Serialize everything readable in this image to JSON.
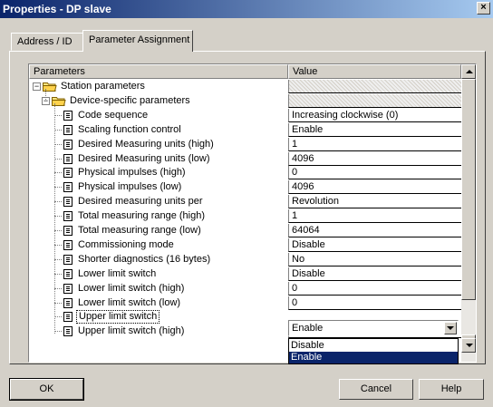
{
  "window": {
    "title": "Properties - DP slave",
    "close_glyph": "×"
  },
  "tabs": [
    {
      "label": "Address / ID",
      "active": false
    },
    {
      "label": "Parameter Assignment",
      "active": true
    }
  ],
  "grid": {
    "columns": {
      "parameters": "Parameters",
      "value": "Value"
    },
    "rows": [
      {
        "label": "Station parameters",
        "value": "",
        "type": "folder"
      },
      {
        "label": "Device-specific parameters",
        "value": "",
        "type": "folder"
      },
      {
        "label": "Code sequence",
        "value": "Increasing clockwise (0)",
        "type": "param"
      },
      {
        "label": "Scaling function control",
        "value": "Enable",
        "type": "param"
      },
      {
        "label": "Desired Measuring units (high)",
        "value": "1",
        "type": "param"
      },
      {
        "label": "Desired Measuring units (low)",
        "value": "4096",
        "type": "param"
      },
      {
        "label": "Physical impulses (high)",
        "value": "0",
        "type": "param"
      },
      {
        "label": "Physical impulses (low)",
        "value": "4096",
        "type": "param"
      },
      {
        "label": "Desired measuring units per",
        "value": "Revolution",
        "type": "param"
      },
      {
        "label": "Total measuring range (high)",
        "value": "1",
        "type": "param"
      },
      {
        "label": "Total measuring range (low)",
        "value": "64064",
        "type": "param"
      },
      {
        "label": "Commissioning mode",
        "value": "Disable",
        "type": "param"
      },
      {
        "label": "Shorter diagnostics (16 bytes)",
        "value": "No",
        "type": "param"
      },
      {
        "label": "Lower limit switch",
        "value": "Disable",
        "type": "param"
      },
      {
        "label": "Lower limit switch (high)",
        "value": "0",
        "type": "param"
      },
      {
        "label": "Lower limit switch (low)",
        "value": "0",
        "type": "param"
      },
      {
        "label": "Upper limit switch",
        "value": "Enable",
        "type": "param",
        "selected": true
      },
      {
        "label": "Upper limit switch (high)",
        "value": "",
        "type": "param"
      }
    ]
  },
  "dropdown": {
    "selected": "Enable",
    "options": [
      {
        "label": "Disable",
        "highlighted": false
      },
      {
        "label": "Enable",
        "highlighted": true
      }
    ]
  },
  "buttons": {
    "ok": "OK",
    "cancel": "Cancel",
    "help": "Help"
  },
  "colors": {
    "titlebar_start": "#0a246a",
    "titlebar_end": "#a6caf0",
    "selection": "#0a246a",
    "face": "#d4d0c8"
  }
}
